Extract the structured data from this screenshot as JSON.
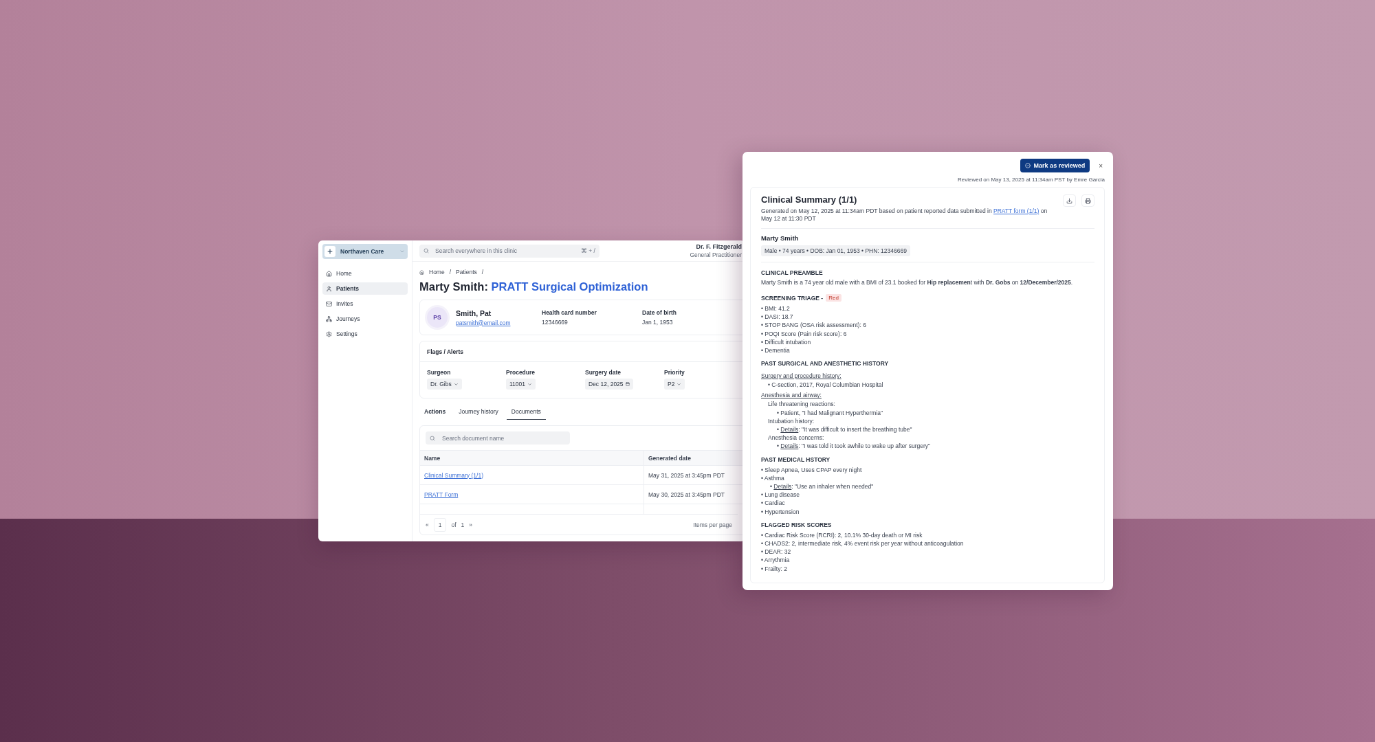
{
  "clinic_window": {
    "sidebar": {
      "clinic_name": "Northaven Care",
      "items": [
        {
          "label": "Home",
          "selected": false
        },
        {
          "label": "Patients",
          "selected": true
        },
        {
          "label": "Invites",
          "selected": false
        },
        {
          "label": "Journeys",
          "selected": false
        },
        {
          "label": "Settings",
          "selected": false
        }
      ]
    },
    "search": {
      "placeholder": "Search everywhere in this clinic",
      "shortcut": "⌘ + /"
    },
    "user": {
      "name": "Dr. F. Fitzgerald",
      "role": "General Practitioner"
    },
    "breadcrumb": [
      {
        "label": "Home",
        "separator": "/"
      },
      {
        "label": "Patients",
        "separator": "/"
      }
    ],
    "title": {
      "patient": "Marty Smith:",
      "program": "PRATT Surgical Optimization"
    },
    "patient": {
      "initials": "PS",
      "name": "Smith, Pat",
      "email": "patsmith@email.com",
      "fields": [
        {
          "label": "Health card number",
          "value": "12346669"
        },
        {
          "label": "Date of birth",
          "value": "Jan 1, 1953"
        }
      ]
    },
    "flags": {
      "title": "Flags / Alerts",
      "fields": [
        {
          "label": "Surgeon",
          "value": "Dr. Gibs",
          "kind": "select"
        },
        {
          "label": "Procedure",
          "value": "11001",
          "kind": "select"
        },
        {
          "label": "Surgery date",
          "value": "Dec 12, 2025",
          "kind": "date"
        },
        {
          "label": "Priority",
          "value": "P2",
          "kind": "select"
        }
      ]
    },
    "tabs": [
      {
        "label": "Actions",
        "kind": "title",
        "selected": false
      },
      {
        "label": "Journey history",
        "kind": "tab",
        "selected": false
      },
      {
        "label": "Documents",
        "kind": "tab",
        "selected": true
      }
    ],
    "documents": {
      "search_placeholder": "Search document name",
      "columns": [
        "Name",
        "Generated date"
      ],
      "rows": [
        {
          "name": "Clinical Summary (1/1)",
          "date": "May 31, 2025 at 3:45pm PDT"
        },
        {
          "name": "PRATT Form",
          "date": "May 30, 2025 at 3:45pm PDT"
        }
      ],
      "pagination": {
        "first": "«",
        "page": "1",
        "of": "of",
        "total": "1",
        "next": "»",
        "items_per_page": "Items per page"
      }
    }
  },
  "summary_panel": {
    "review_button": "Mark as reviewed",
    "close": "×",
    "reviewed_note": "Reviewed on May 13, 2025 at 11:34am PST by Emre Garcia",
    "title": "Clinical Summary (1/1)",
    "generated": {
      "before": "Generated on May 12, 2025 at 11:34am PDT based on patient reported data submitted in",
      "link": "PRATT form (1/1)",
      "after": "on May 12 at 11:30 PDT"
    },
    "patient_name": "Marty Smith",
    "patient_facts": "Male • 74 years • DOB: Jan 01, 1953 •  PHN: 12346669",
    "sections": [
      {
        "heading": "CLINICAL PREAMBLE",
        "blocks": [
          {
            "kind": "paragraph",
            "text": "Marty Smith is a 74 year old male with a BMI of 23.1 booked for **Hip replacemen**t with **Dr. Gobs** on **12/December/2025**."
          }
        ]
      },
      {
        "heading": "SCREENING TRIAGE -",
        "badge": "Red",
        "blocks": [
          {
            "kind": "bullet",
            "text": "• BMI: 41.2"
          },
          {
            "kind": "bullet",
            "text": "• DASI: 18.7"
          },
          {
            "kind": "bullet",
            "text": "• STOP BANG (OSA risk assessment): 6"
          },
          {
            "kind": "bullet",
            "text": "• POQI Score (Pain risk score): 6"
          },
          {
            "kind": "bullet",
            "text": "• Difficult intubation"
          },
          {
            "kind": "bullet",
            "text": "• Dementia"
          }
        ]
      },
      {
        "heading": "PAST SURGICAL AND ANESTHETIC HISTORY",
        "blocks": [
          {
            "kind": "subheading",
            "text": "Surgery and procedure history:",
            "children": [
              {
                "kind": "bullet",
                "text": "• C-section, 2017, Royal Columbian Hospital"
              }
            ]
          },
          {
            "kind": "subheading",
            "text": "Anesthesia and airway:",
            "children": [
              {
                "kind": "line",
                "text": "Life threatening reactions:",
                "children": [
                  {
                    "kind": "bullet",
                    "text": "• Patient, \"I had Malignant Hyperthermia\""
                  }
                ]
              },
              {
                "kind": "line",
                "text": "Intubation history:",
                "children": [
                  {
                    "kind": "detail",
                    "marker": "•",
                    "label": "Details",
                    "text": ": \"It was difficult to insert the breathing tube\""
                  }
                ]
              },
              {
                "kind": "line",
                "text": "Anesthesia concerns:",
                "children": [
                  {
                    "kind": "detail",
                    "marker": "•",
                    "label": "Details",
                    "text": ": \"I was told it took awhile to wake up after surgery\""
                  }
                ]
              }
            ]
          }
        ]
      },
      {
        "heading": "PAST MEDICAL HSTORY",
        "blocks": [
          {
            "kind": "bullet",
            "text": "• Sleep Apnea, Uses CPAP every night"
          },
          {
            "kind": "bullet",
            "text": "• Asthma",
            "children": [
              {
                "kind": "detail",
                "marker": "•",
                "label": "Details",
                "text": ": \"Use an inhaler when needed\""
              }
            ]
          },
          {
            "kind": "bullet",
            "text": "• Lung disease"
          },
          {
            "kind": "bullet",
            "text": "• Cardiac"
          },
          {
            "kind": "bullet",
            "text": "• Hypertension"
          }
        ]
      },
      {
        "heading": "FLAGGED RISK SCORES",
        "blocks": [
          {
            "kind": "bullet",
            "text": "• Cardiac Risk Score (RCRI): 2, 10.1% 30-day death or MI risk"
          },
          {
            "kind": "bullet",
            "text": "• CHADS2: 2, intermediate risk, 4% event risk per year without anticoagulation"
          },
          {
            "kind": "bullet",
            "text": "• DEAR: 32"
          },
          {
            "kind": "bullet",
            "text": "• Arrythmia"
          },
          {
            "kind": "bullet",
            "text": "• Frailty: 2"
          }
        ]
      }
    ]
  }
}
